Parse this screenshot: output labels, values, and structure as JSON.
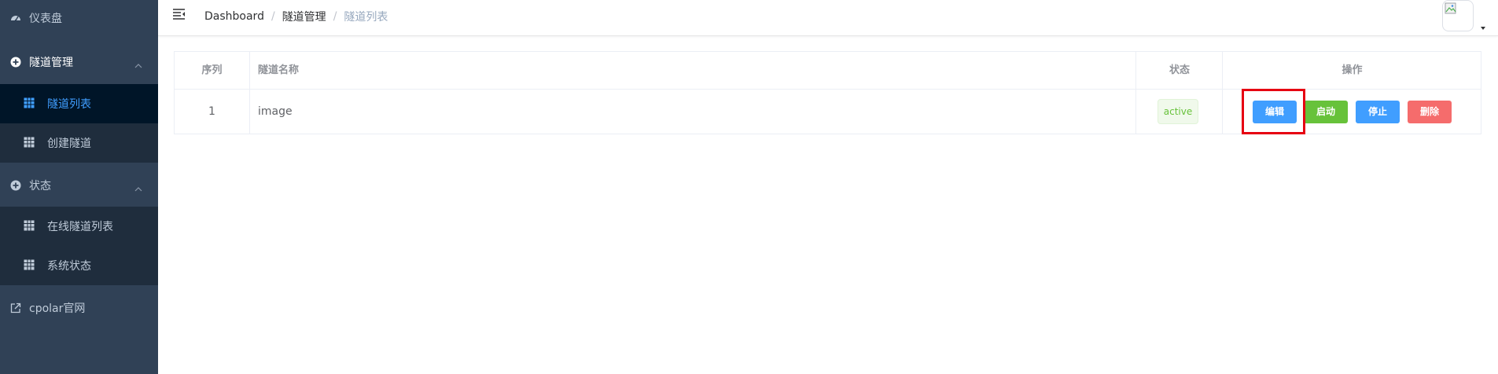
{
  "sidebar": {
    "dashboard": "仪表盘",
    "tunnel_mgmt": "隧道管理",
    "tunnel_list": "隧道列表",
    "create_tunnel": "创建隧道",
    "status": "状态",
    "online_tunnels": "在线隧道列表",
    "system_status": "系统状态",
    "official_site": "cpolar官网"
  },
  "breadcrumb": [
    "Dashboard",
    "隧道管理",
    "隧道列表"
  ],
  "table": {
    "headers": [
      "序列",
      "隧道名称",
      "状态",
      "操作"
    ],
    "rows": [
      {
        "index": "1",
        "name": "image",
        "status": "active"
      }
    ]
  },
  "actions": {
    "edit": "编辑",
    "start": "启动",
    "stop": "停止",
    "delete": "删除"
  },
  "colors": {
    "sidebar_bg": "#304156",
    "submenu_bg": "#1f2d3d",
    "active_submenu_bg": "#001528",
    "primary": "#409eff",
    "success": "#67c23a",
    "danger": "#f56c6c",
    "highlight": "#e60012"
  },
  "icons": {
    "dashboard": "dashboard-icon",
    "tunnel_mgmt": "plus-circle-icon",
    "status": "plus-circle-icon",
    "table": "table-grid-icon",
    "official_site": "external-link-icon",
    "hamburger": "hamburger-icon",
    "avatar": "broken-image-icon",
    "caret": "caret-down-icon"
  }
}
